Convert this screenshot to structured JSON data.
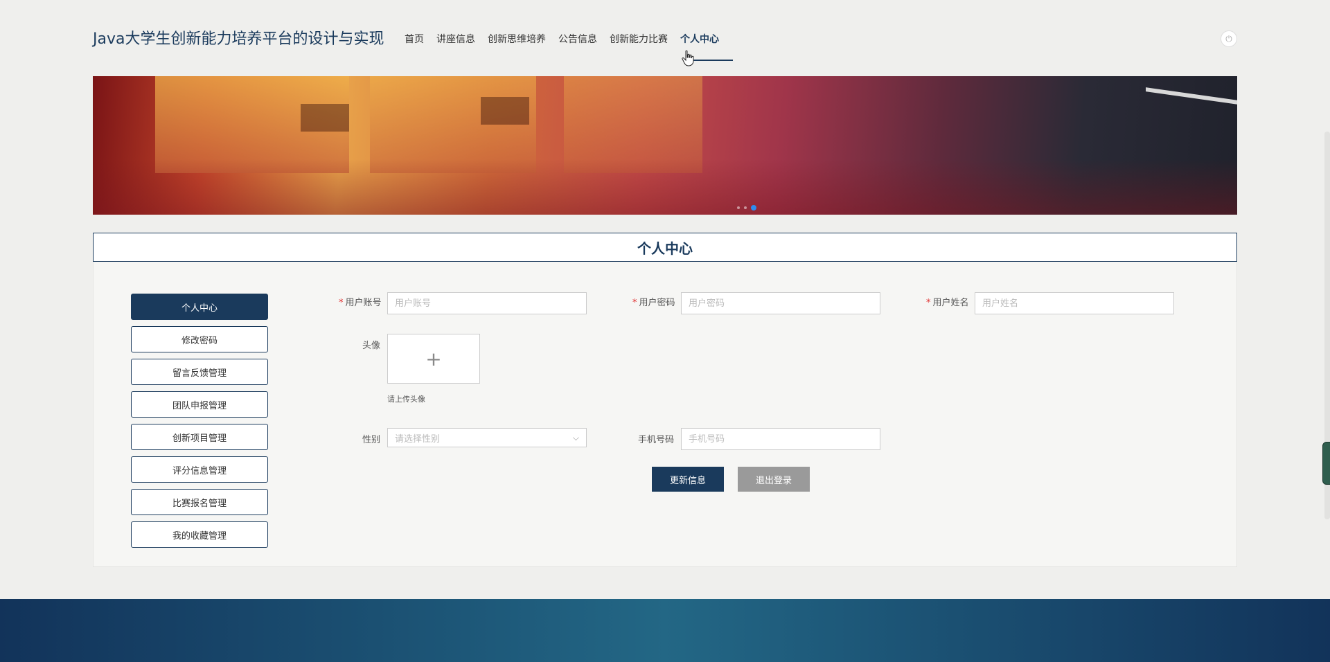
{
  "header": {
    "site_title": "Java大学生创新能力培养平台的设计与实现",
    "nav": [
      {
        "label": "首页"
      },
      {
        "label": "讲座信息"
      },
      {
        "label": "创新思维培养"
      },
      {
        "label": "公告信息"
      },
      {
        "label": "创新能力比赛"
      },
      {
        "label": "个人中心",
        "active": true
      }
    ],
    "power_icon": "power-icon"
  },
  "banner": {
    "slides_count": 3,
    "active_slide": 3
  },
  "section": {
    "title": "个人中心"
  },
  "side_menu": {
    "items": [
      {
        "label": "个人中心",
        "active": true
      },
      {
        "label": "修改密码"
      },
      {
        "label": "留言反馈管理"
      },
      {
        "label": "团队申报管理"
      },
      {
        "label": "创新项目管理"
      },
      {
        "label": "评分信息管理"
      },
      {
        "label": "比赛报名管理"
      },
      {
        "label": "我的收藏管理"
      }
    ]
  },
  "form": {
    "account": {
      "required_mark": "*",
      "label": "用户账号",
      "placeholder": "用户账号",
      "value": ""
    },
    "password": {
      "required_mark": "*",
      "label": "用户密码",
      "placeholder": "用户密码",
      "value": ""
    },
    "name": {
      "required_mark": "*",
      "label": "用户姓名",
      "placeholder": "用户姓名",
      "value": ""
    },
    "avatar": {
      "label": "头像",
      "plus": "+",
      "hint": "请上传头像"
    },
    "gender": {
      "label": "性别",
      "placeholder": "请选择性别"
    },
    "phone": {
      "label": "手机号码",
      "placeholder": "手机号码",
      "value": ""
    },
    "update_button": "更新信息",
    "logout_button": "退出登录"
  },
  "colors": {
    "primary": "#1a3a5c",
    "secondary_button": "#9a9a9a",
    "required": "#e03030",
    "carousel_active": "#2d8cf0"
  }
}
